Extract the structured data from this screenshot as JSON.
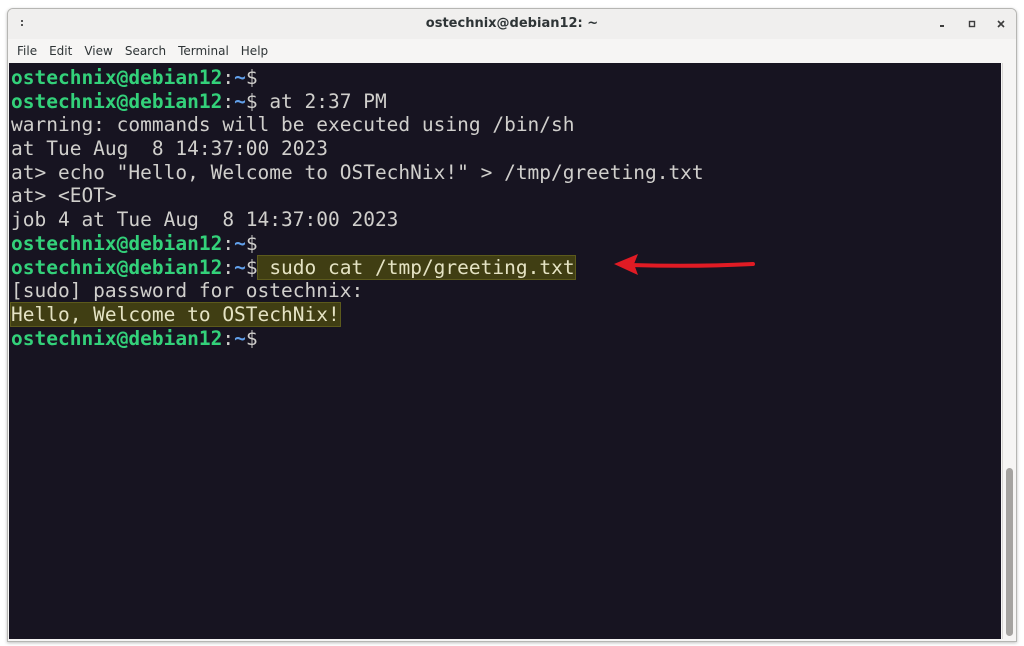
{
  "window": {
    "title": "ostechnix@debian12: ~"
  },
  "menu": [
    "File",
    "Edit",
    "View",
    "Search",
    "Terminal",
    "Help"
  ],
  "prompt": {
    "user_host": "ostechnix@debian12",
    "colon": ":",
    "path": "~",
    "symbol": "$"
  },
  "terminal": {
    "cmd_at": " at 2:37 PM",
    "line_warning": "warning: commands will be executed using /bin/sh",
    "line_at_time": "at Tue Aug  8 14:37:00 2023",
    "line_at_echo": "at> echo \"Hello, Welcome to OSTechNix!\" > /tmp/greeting.txt",
    "line_at_eot": "at> <EOT>",
    "line_job": "job 4 at Tue Aug  8 14:37:00 2023",
    "cmd_sudo": " sudo cat /tmp/greeting.txt",
    "line_sudo_pw": "[sudo] password for ostechnix:",
    "line_output": "Hello, Welcome to OSTechNix!"
  },
  "colors": {
    "terminal_bg": "#171421",
    "prompt_user": "#33d17a",
    "prompt_path": "#62a0ea",
    "highlight_bg": "#403e13",
    "annotation_arrow": "#e01b24"
  },
  "icons": {
    "window_icon": "terminal-menu-icon",
    "minimize": "minimize-icon",
    "maximize": "maximize-icon",
    "close": "close-icon",
    "annotation": "red-arrow-icon"
  }
}
